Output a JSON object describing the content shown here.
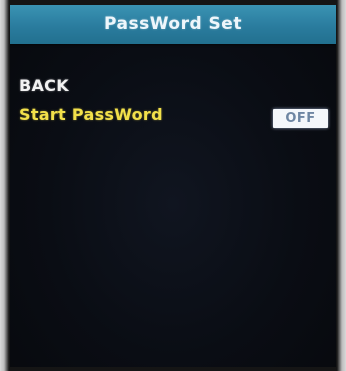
{
  "header": {
    "title": "PassWord Set"
  },
  "menu": {
    "back_label": "BACK",
    "start_password_label": "Start PassWord",
    "start_password_value": "OFF"
  },
  "colors": {
    "title_bar": "#2a7c9e",
    "screen_background": "#0a0d14",
    "selected_item_text": "#f2e04a",
    "normal_item_text": "#f2f2f2",
    "toggle_background": "#f4f7fb"
  }
}
